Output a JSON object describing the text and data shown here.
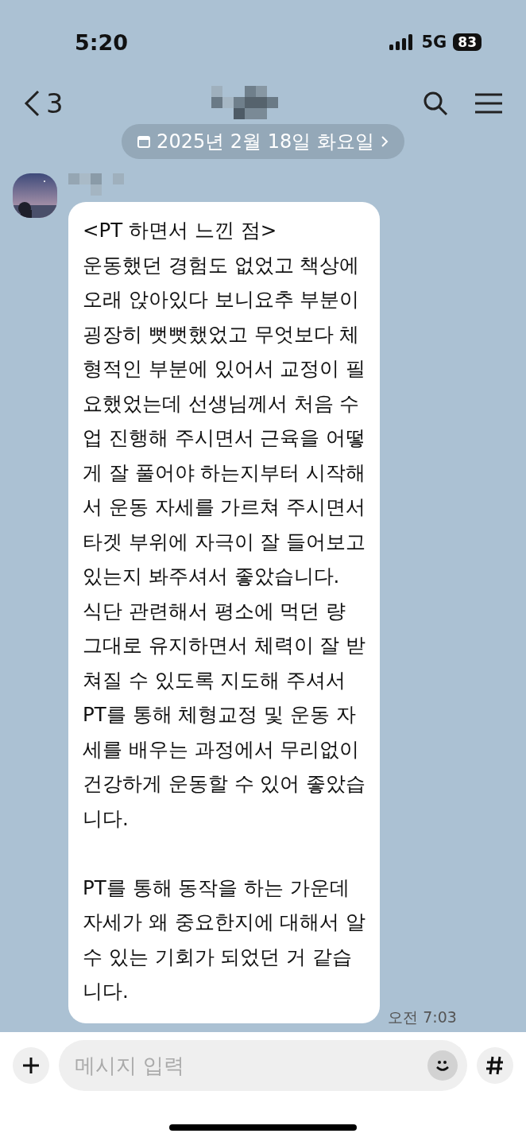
{
  "status_bar": {
    "time": "5:20",
    "network": "5G",
    "battery": "83"
  },
  "header": {
    "back_count": "3"
  },
  "date_divider": "2025년 2월 18일 화요일",
  "messages": [
    {
      "text": "<PT 하면서 느낀 점>\n운동했던 경험도 없었고 책상에\n오래 앉아있다 보니요추 부분이\n굉장히 뻣뻣했었고 무엇보다 체\n형적인 부분에 있어서 교정이 필\n요했었는데 선생님께서 처음 수\n업 진행해 주시면서 근육을 어떻\n게 잘 풀어야 하는지부터 시작해\n서 운동 자세를 가르쳐 주시면서\n타겟 부위에 자극이 잘 들어보고\n있는지 봐주셔서 좋았습니다.\n식단 관련해서 평소에 먹던 량\n그대로 유지하면서 체력이 잘 받\n쳐질 수 있도록 지도해 주셔서\nPT를 통해 체형교정 및 운동 자\n세를 배우는 과정에서 무리없이\n건강하게 운동할 수 있어 좋았습\n니다.\n\nPT를 통해 동작을 하는 가운데\n자세가 왜 중요한지에 대해서 알\n수 있는 기회가 되었던 거 같습\n니다.",
      "time": "오전 7:03"
    }
  ],
  "composer": {
    "placeholder": "메시지 입력"
  }
}
